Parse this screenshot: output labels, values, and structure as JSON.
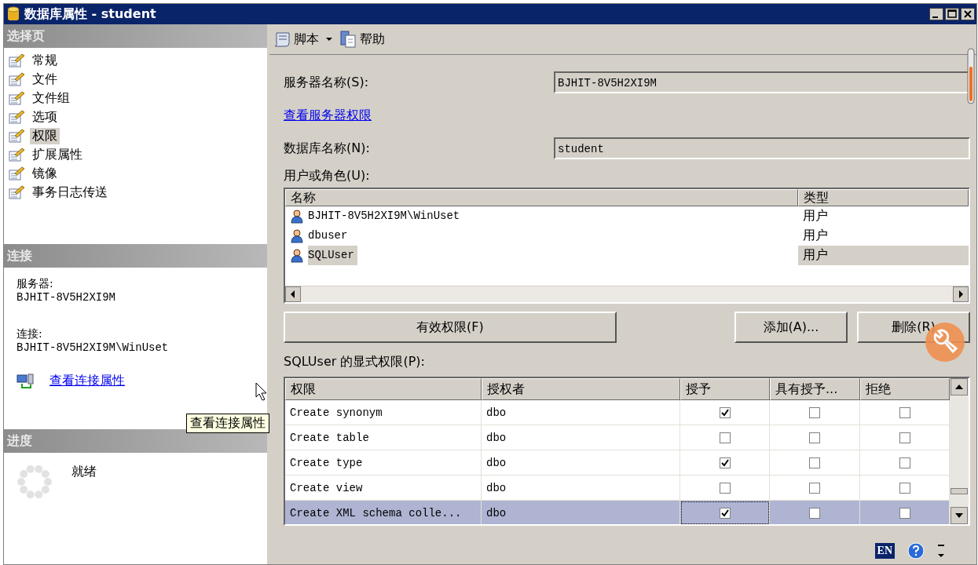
{
  "window": {
    "title": "数据库属性 - student"
  },
  "sidebar": {
    "header": "选择页",
    "items": [
      {
        "label": "常规",
        "selected": false
      },
      {
        "label": "文件",
        "selected": false
      },
      {
        "label": "文件组",
        "selected": false
      },
      {
        "label": "选项",
        "selected": false
      },
      {
        "label": "权限",
        "selected": true
      },
      {
        "label": "扩展属性",
        "selected": false
      },
      {
        "label": "镜像",
        "selected": false
      },
      {
        "label": "事务日志传送",
        "selected": false
      }
    ]
  },
  "connection": {
    "header": "连接",
    "server_label": "服务器:",
    "server": "BJHIT-8V5H2XI9M",
    "connection_label": "连接:",
    "connection": "BJHIT-8V5H2XI9M\\WinUset",
    "link": "查看连接属性",
    "tooltip": "查看连接属性"
  },
  "progress": {
    "header": "进度",
    "status": "就绪"
  },
  "toolbar": {
    "script": "脚本",
    "help": "帮助"
  },
  "form": {
    "server_label": "服务器名称(S):",
    "server": "BJHIT-8V5H2XI9M",
    "server_link": "查看服务器权限",
    "database_label": "数据库名称(N):",
    "database": "student",
    "users_label": "用户或角色(U):"
  },
  "users": {
    "columns": [
      "名称",
      "类型"
    ],
    "rows": [
      {
        "name": "BJHIT-8V5H2XI9M\\WinUset",
        "type": "用户",
        "selected": false
      },
      {
        "name": "dbuser",
        "type": "用户",
        "selected": false
      },
      {
        "name": "SQLUser",
        "type": "用户",
        "selected": true
      }
    ]
  },
  "buttons": {
    "effective": "有效权限(F)",
    "add": "添加(A)...",
    "remove": "删除(R)"
  },
  "permissions": {
    "label": "SQLUser 的显式权限(P):",
    "columns": [
      "权限",
      "授权者",
      "授予",
      "具有授予...",
      "拒绝"
    ],
    "rows": [
      {
        "permission": "Create synonym",
        "grantor": "dbo",
        "grant": true,
        "with_grant": false,
        "deny": false,
        "selected": false
      },
      {
        "permission": "Create table",
        "grantor": "dbo",
        "grant": false,
        "with_grant": false,
        "deny": false,
        "selected": false
      },
      {
        "permission": "Create type",
        "grantor": "dbo",
        "grant": true,
        "with_grant": false,
        "deny": false,
        "selected": false
      },
      {
        "permission": "Create view",
        "grantor": "dbo",
        "grant": false,
        "with_grant": false,
        "deny": false,
        "selected": false
      },
      {
        "permission": "Create XML schema colle...",
        "grantor": "dbo",
        "grant": true,
        "with_grant": false,
        "deny": false,
        "selected": true
      }
    ]
  },
  "status_bar": {
    "language": "EN"
  }
}
